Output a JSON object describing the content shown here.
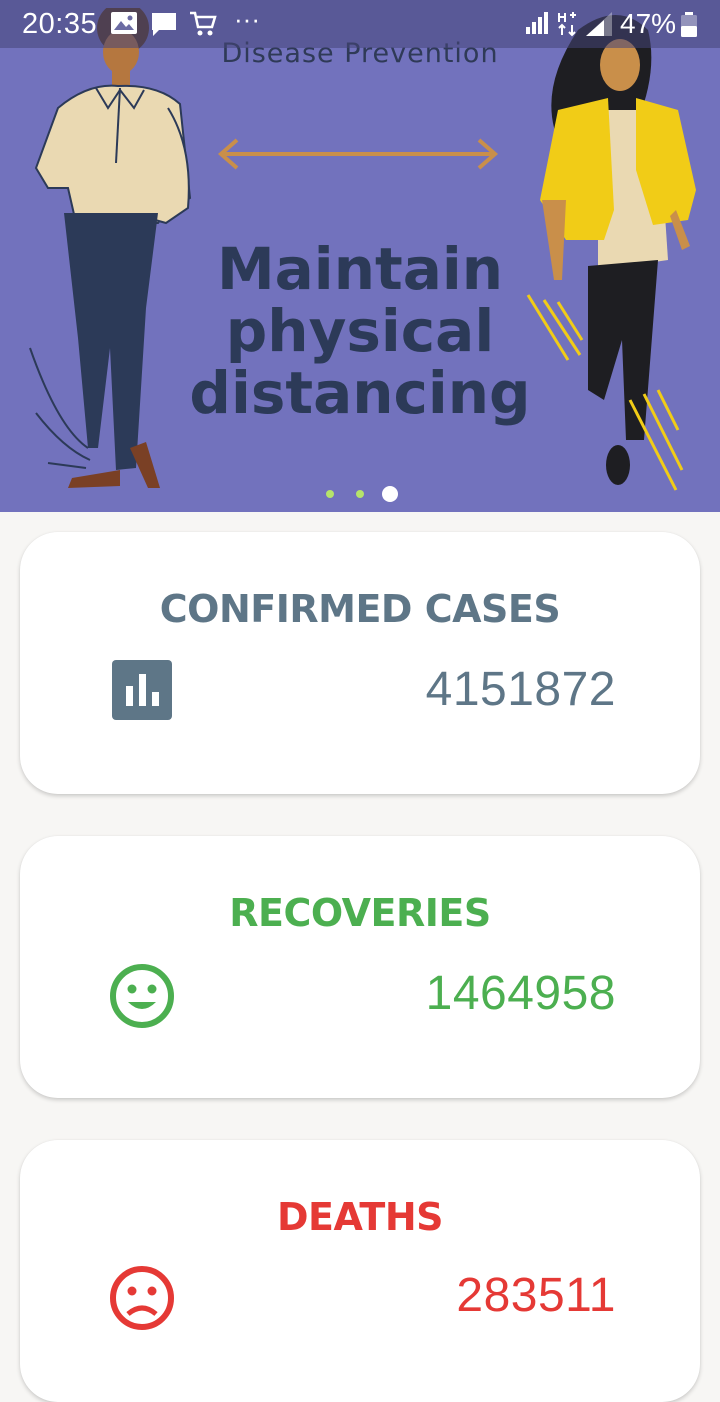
{
  "status_bar": {
    "time": "20:35",
    "dots": "···",
    "battery_percent": "47%"
  },
  "banner": {
    "caption": "Disease Prevention",
    "headline_lines": [
      "Maintain",
      "physical",
      "distancing"
    ],
    "carousel": {
      "page_count": 3,
      "active_index": 2
    }
  },
  "stats": {
    "confirmed": {
      "title": "CONFIRMED CASES",
      "value": "4151872",
      "icon": "bar-chart-icon",
      "color": "#5e7687"
    },
    "recoveries": {
      "title": "RECOVERIES",
      "value": "1464958",
      "icon": "smile-icon",
      "color": "#4caf50"
    },
    "deaths": {
      "title": "DEATHS",
      "value": "283511",
      "icon": "sad-face-icon",
      "color": "#e53935"
    }
  },
  "colors": {
    "banner_bg": "#7272bd",
    "page_bg": "#f7f6f4",
    "dot_inactive": "#b6e46a",
    "dot_active": "#ffffff"
  }
}
